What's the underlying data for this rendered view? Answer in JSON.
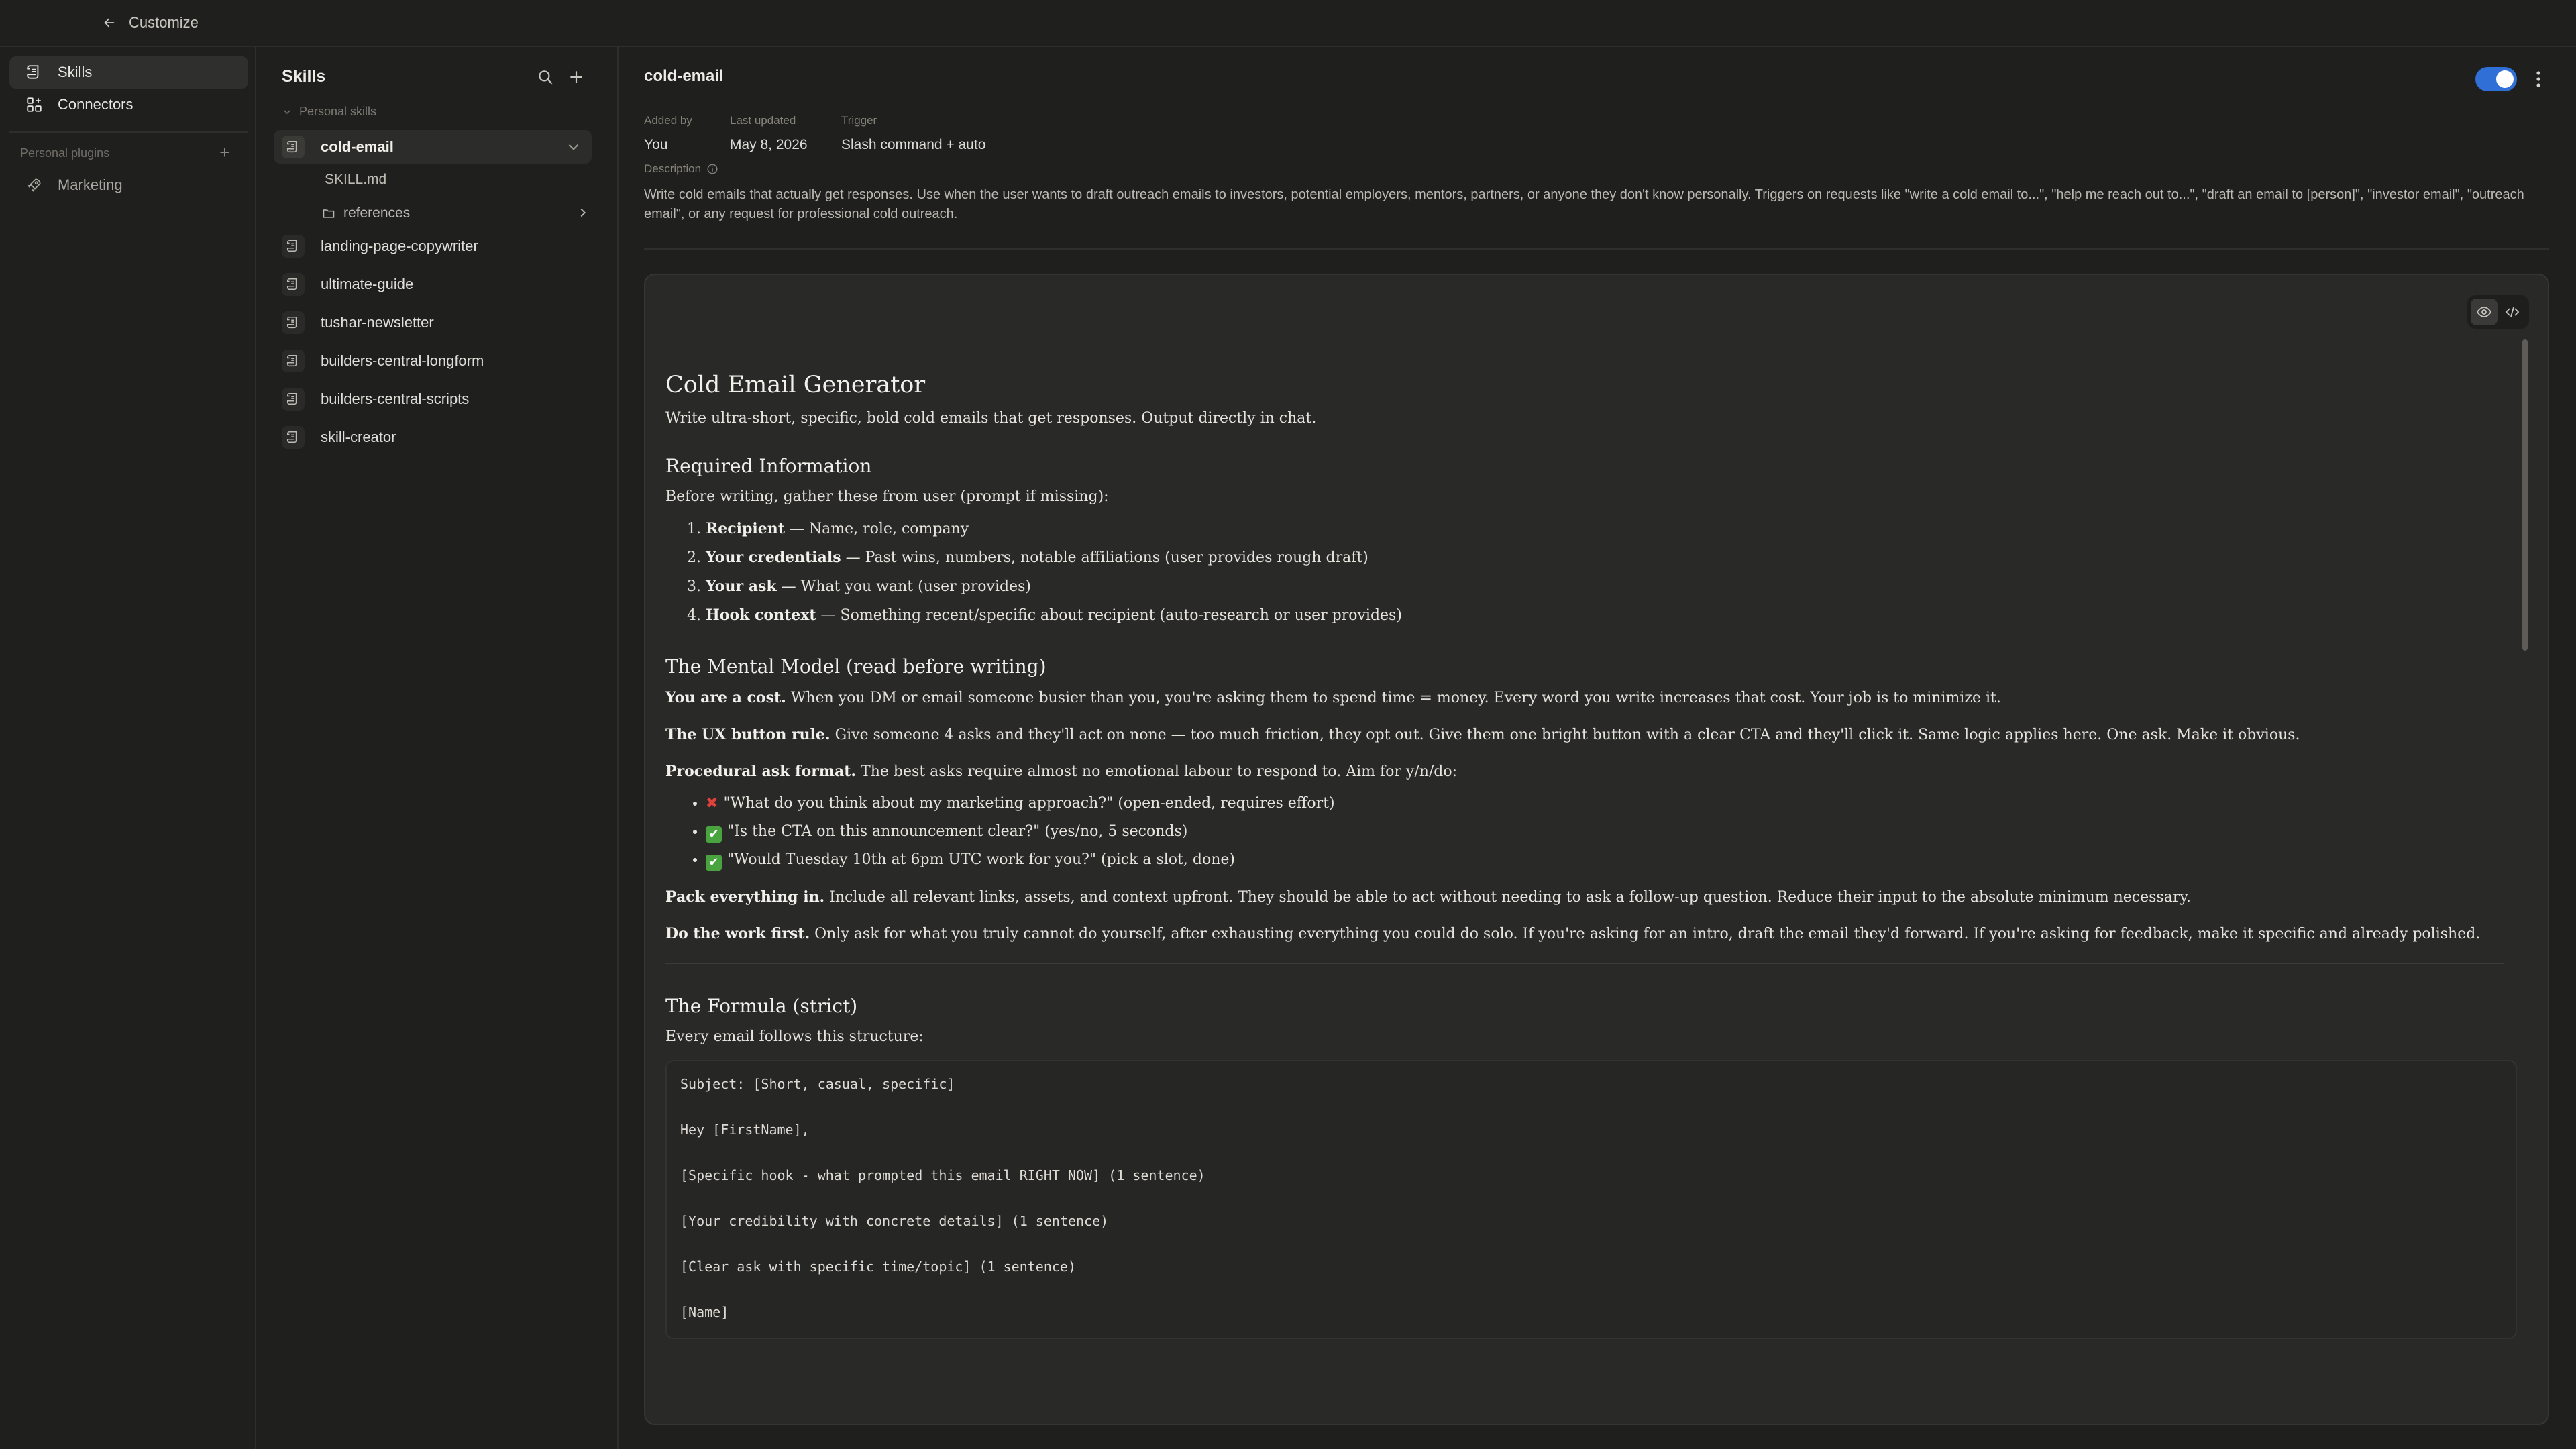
{
  "topbar": {
    "back_label": "Customize"
  },
  "leftnav": {
    "items": [
      {
        "label": "Skills",
        "icon": "scroll-icon",
        "active": true
      },
      {
        "label": "Connectors",
        "icon": "grid-plus-icon",
        "active": false
      }
    ],
    "plugins_label": "Personal plugins",
    "plugins": [
      {
        "label": "Marketing",
        "icon": "rocket-icon"
      }
    ]
  },
  "skills": {
    "title": "Skills",
    "section_label": "Personal skills",
    "active_skill": "cold-email",
    "files": [
      {
        "label": "SKILL.md"
      },
      {
        "label": "references"
      }
    ],
    "others": [
      "landing-page-copywriter",
      "ultimate-guide",
      "tushar-newsletter",
      "builders-central-longform",
      "builders-central-scripts",
      "skill-creator"
    ]
  },
  "main": {
    "title": "cold-email",
    "enabled": true,
    "accent_color": "#2f6fd6",
    "meta": {
      "added_by_label": "Added by",
      "added_by": "You",
      "updated_label": "Last updated",
      "updated": "May 8, 2026",
      "trigger_label": "Trigger",
      "trigger": "Slash command + auto"
    },
    "description_label": "Description",
    "description": "Write cold emails that actually get responses. Use when the user wants to draft outreach emails to investors, potential employers, mentors, partners, or anyone they don't know personally. Triggers on requests like \"write a cold email to...\", \"help me reach out to...\", \"draft an email to [person]\", \"investor email\", \"outreach email\", or any request for professional cold outreach."
  },
  "doc": {
    "h1": "Cold Email Generator",
    "intro": "Write ultra-short, specific, bold cold emails that get responses. Output directly in chat.",
    "req_heading": "Required Information",
    "req_intro": "Before writing, gather these from user (prompt if missing):",
    "req_items": [
      {
        "bold": "Recipient",
        "text": " — Name, role, company"
      },
      {
        "bold": "Your credentials",
        "text": " — Past wins, numbers, notable affiliations (user provides rough draft)"
      },
      {
        "bold": "Your ask",
        "text": " — What you want (user provides)"
      },
      {
        "bold": "Hook context",
        "text": " — Something recent/specific about recipient (auto-research or user provides)"
      }
    ],
    "mm_heading": "The Mental Model (read before writing)",
    "mm_p1_bold": "You are a cost.",
    "mm_p1": " When you DM or email someone busier than you, you're asking them to spend time = money. Every word you write increases that cost. Your job is to minimize it.",
    "mm_p2_bold": "The UX button rule.",
    "mm_p2": " Give someone 4 asks and they'll act on none — too much friction, they opt out. Give them one bright button with a clear CTA and they'll click it. Same logic applies here. One ask. Make it obvious.",
    "mm_p3_bold": "Procedural ask format.",
    "mm_p3": " The best asks require almost no emotional labour to respond to. Aim for y/n/do:",
    "mm_examples": [
      {
        "mark": "✖",
        "kind": "bad",
        "text": "\"What do you think about my marketing approach?\" (open-ended, requires effort)"
      },
      {
        "mark": "✔",
        "kind": "good",
        "text": "\"Is the CTA on this announcement clear?\" (yes/no, 5 seconds)"
      },
      {
        "mark": "✔",
        "kind": "good",
        "text": "\"Would Tuesday 10th at 6pm UTC work for you?\" (pick a slot, done)"
      }
    ],
    "mm_p4_bold": "Pack everything in.",
    "mm_p4": " Include all relevant links, assets, and context upfront. They should be able to act without needing to ask a follow-up question. Reduce their input to the absolute minimum necessary.",
    "mm_p5_bold": "Do the work first.",
    "mm_p5": " Only ask for what you truly cannot do yourself, after exhausting everything you could do solo. If you're asking for an intro, draft the email they'd forward. If you're asking for feedback, make it specific and already polished.",
    "formula_heading": "The Formula (strict)",
    "formula_intro": "Every email follows this structure:",
    "code_lines": [
      "Subject: [Short, casual, specific]",
      "Hey [FirstName],",
      "[Specific hook - what prompted this email RIGHT NOW] (1 sentence)",
      "[Your credibility with concrete details] (1 sentence)",
      "[Clear ask with specific time/topic] (1 sentence)",
      "[Name]"
    ]
  }
}
